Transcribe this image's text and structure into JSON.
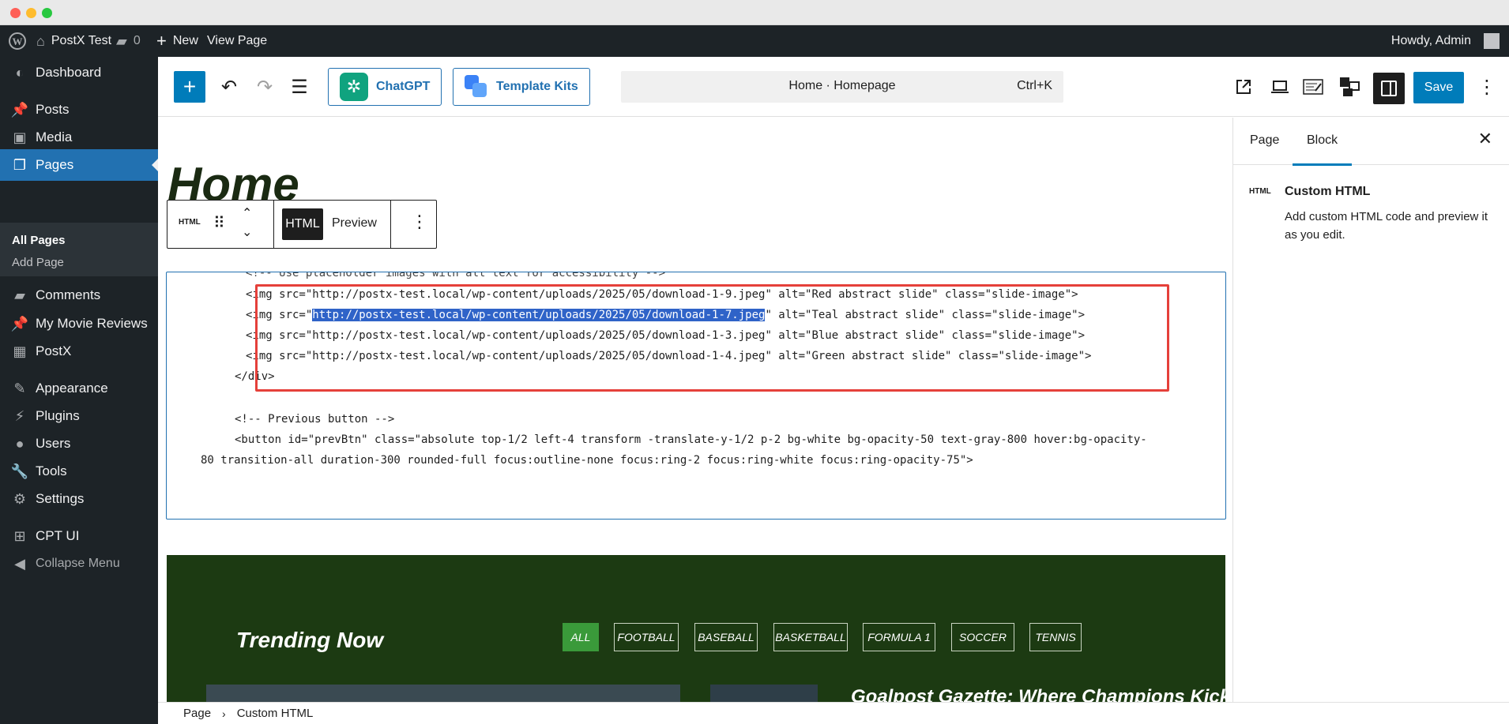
{
  "window": {
    "buttons": [
      "close",
      "minimize",
      "zoom"
    ]
  },
  "adminbar": {
    "site_name": "PostX Test",
    "comments_count": "0",
    "new_label": "New",
    "view_page_label": "View Page",
    "howdy": "Howdy, Admin"
  },
  "sidebar": {
    "items": [
      {
        "label": "Dashboard",
        "icon": "dashboard-icon"
      },
      {
        "label": "Posts",
        "icon": "pin-icon"
      },
      {
        "label": "Media",
        "icon": "media-icon"
      },
      {
        "label": "Pages",
        "icon": "pages-icon",
        "active": true
      },
      {
        "label": "Comments",
        "icon": "comment-icon"
      },
      {
        "label": "My Movie Reviews",
        "icon": "pin-icon"
      },
      {
        "label": "PostX",
        "icon": "grid-icon"
      },
      {
        "label": "Appearance",
        "icon": "brush-icon"
      },
      {
        "label": "Plugins",
        "icon": "plug-icon"
      },
      {
        "label": "Users",
        "icon": "user-icon"
      },
      {
        "label": "Tools",
        "icon": "wrench-icon"
      },
      {
        "label": "Settings",
        "icon": "settings-icon"
      },
      {
        "label": "CPT UI",
        "icon": "cpt-icon"
      }
    ],
    "submenu": [
      {
        "label": "All Pages",
        "current": true
      },
      {
        "label": "Add Page"
      }
    ],
    "collapse_label": "Collapse Menu"
  },
  "toolbar": {
    "chatgpt_label": "ChatGPT",
    "template_kits_label": "Template Kits",
    "document_title": "Home · Homepage",
    "shortcut": "Ctrl+K",
    "save_label": "Save"
  },
  "canvas": {
    "page_title": "Home",
    "block_toolbar": {
      "block_icon": "HTML",
      "html_tab": "HTML",
      "preview_tab": "Preview"
    },
    "code": {
      "line_partial": "<!-- Use placeholder images with alt text for accessibility -->",
      "img1": "<img src=\"http://postx-test.local/wp-content/uploads/2025/05/download-1-9.jpeg\" alt=\"Red abstract slide\" class=\"slide-image\">",
      "img2_prefix": "<img src=\"",
      "img2_selected": "http://postx-test.local/wp-content/uploads/2025/05/download-1-7.jpeg",
      "img2_suffix": "\" alt=\"Teal abstract slide\" class=\"slide-image\">",
      "img3": "<img src=\"http://postx-test.local/wp-content/uploads/2025/05/download-1-3.jpeg\" alt=\"Blue abstract slide\" class=\"slide-image\">",
      "img4": "<img src=\"http://postx-test.local/wp-content/uploads/2025/05/download-1-4.jpeg\" alt=\"Green abstract slide\" class=\"slide-image\">",
      "div_close": "</div>",
      "comment_prev": "<!-- Previous button -->",
      "button_line1": "<button id=\"prevBtn\" class=\"absolute top-1/2 left-4 transform -translate-y-1/2 p-2 bg-white bg-opacity-50 text-gray-800 hover:bg-opacity-",
      "button_line2": "80 transition-all duration-300 rounded-full focus:outline-none focus:ring-2 focus:ring-white focus:ring-opacity-75\">"
    },
    "trending": {
      "title": "Trending Now",
      "filters": [
        "ALL",
        "FOOTBALL",
        "BASEBALL",
        "BASKETBALL",
        "FORMULA 1",
        "SOCCER",
        "TENNIS"
      ],
      "active_filter": "ALL",
      "headline": "Goalpost Gazette: Where Champions Kick"
    }
  },
  "breadcrumb": {
    "items": [
      "Page",
      "Custom HTML"
    ]
  },
  "settings": {
    "tabs": [
      "Page",
      "Block"
    ],
    "active_tab": "Block",
    "block_icon": "HTML",
    "block_title": "Custom HTML",
    "block_description": "Add custom HTML code and preview it as you edit."
  },
  "colors": {
    "admin_bg": "#1d2327",
    "accent": "#2271b1",
    "highlight": "#e5403a",
    "trending_bg": "#1c3a12",
    "active_filter": "#3a9a3a"
  }
}
